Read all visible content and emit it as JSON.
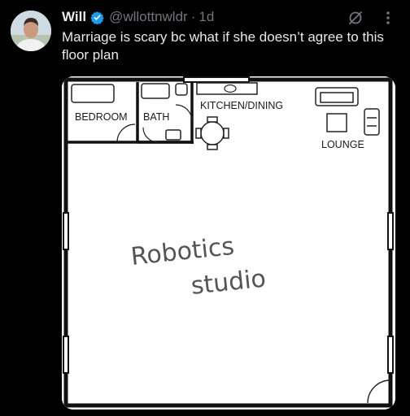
{
  "tweet": {
    "author_name": "Will",
    "handle": "@wllottnwldr",
    "separator": "·",
    "time": "1d",
    "text": "Marriage is scary bc what if she doesn’t agree to this floor plan",
    "verified_color": "#1d9bf0"
  },
  "floor_plan": {
    "rooms": {
      "bedroom": "BEDROOM",
      "bath": "BATH",
      "kitchen": "KITCHEN/DINING",
      "lounge": "LOUNGE"
    },
    "handwritten_line1": "Robotics",
    "handwritten_line2": "studio"
  }
}
